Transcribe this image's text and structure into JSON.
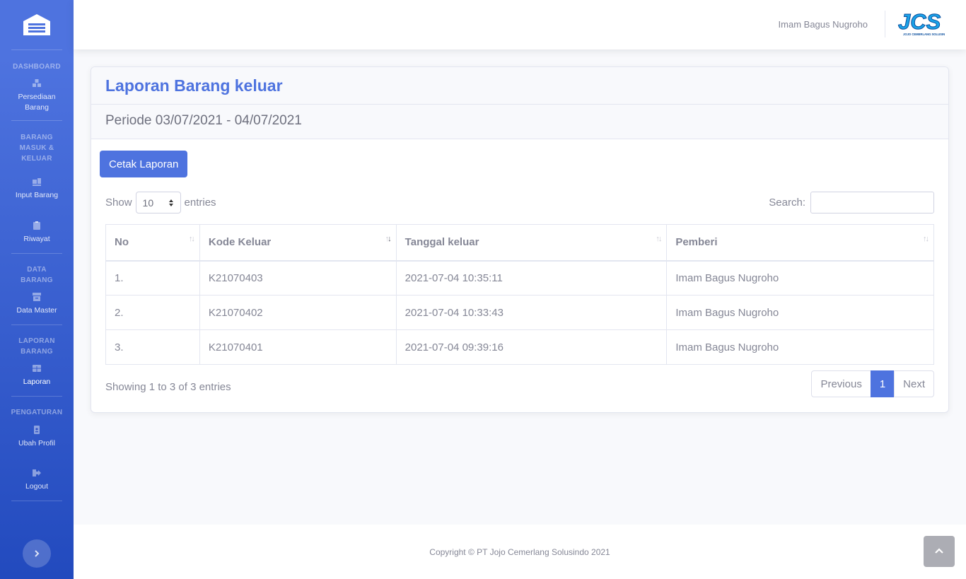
{
  "sidebar": {
    "sections": [
      {
        "heading": "DASHBOARD",
        "items": [
          {
            "label": "Persediaan Barang",
            "icon": "boxes-icon"
          }
        ]
      },
      {
        "heading": "BARANG MASUK & KELUAR",
        "items": [
          {
            "label": "Input Barang",
            "icon": "dolly-icon"
          },
          {
            "label": "Riwayat",
            "icon": "clipboard-icon"
          }
        ]
      },
      {
        "heading": "DATA BARANG",
        "items": [
          {
            "label": "Data Master",
            "icon": "archive-icon"
          }
        ]
      },
      {
        "heading": "LAPORAN BARANG",
        "items": [
          {
            "label": "Laporan",
            "icon": "table-icon"
          }
        ]
      },
      {
        "heading": "PENGATURAN",
        "items": [
          {
            "label": "Ubah Profil",
            "icon": "id-badge-icon"
          },
          {
            "label": "Logout",
            "icon": "sign-out-icon"
          }
        ]
      }
    ]
  },
  "topbar": {
    "user_name": "Imam Bagus Nugroho",
    "logo_text": "JCS",
    "logo_subtext": "JOJO CEMERLANG SOLUSINDO"
  },
  "card": {
    "title": "Laporan Barang keluar",
    "period": "Periode 03/07/2021 - 04/07/2021",
    "print_button": "Cetak Laporan"
  },
  "table_controls": {
    "show_label": "Show",
    "entries_label": "entries",
    "length_value": "10",
    "search_label": "Search:",
    "search_value": ""
  },
  "table": {
    "headers": [
      "No",
      "Kode Keluar",
      "Tanggal keluar",
      "Pemberi"
    ],
    "rows": [
      [
        "1.",
        "K21070403",
        "2021-07-04 10:35:11",
        "Imam Bagus Nugroho"
      ],
      [
        "2.",
        "K21070402",
        "2021-07-04 10:33:43",
        "Imam Bagus Nugroho"
      ],
      [
        "3.",
        "K21070401",
        "2021-07-04 09:39:16",
        "Imam Bagus Nugroho"
      ]
    ]
  },
  "pagination": {
    "info": "Showing 1 to 3 of 3 entries",
    "previous": "Previous",
    "current": "1",
    "next": "Next"
  },
  "footer": {
    "copyright": "Copyright © PT Jojo Cemerlang Solusindo 2021"
  },
  "colors": {
    "primary": "#4e73df",
    "sidebar_end": "#224abe",
    "text_muted": "#858796"
  }
}
